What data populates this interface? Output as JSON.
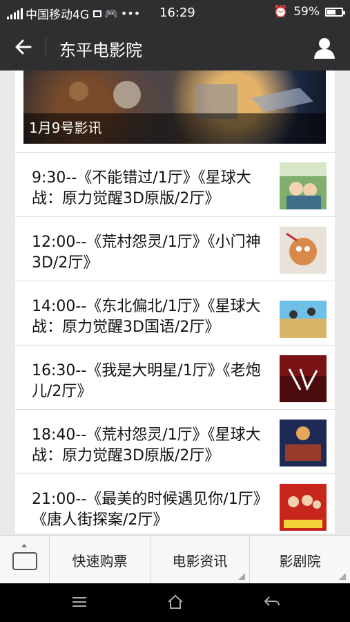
{
  "status": {
    "carrier": "中国移动4G",
    "time": "16:29",
    "battery": "59%",
    "battery_fraction": 0.59
  },
  "header": {
    "title": "东平电影院"
  },
  "banner": {
    "caption": "1月9号影讯"
  },
  "schedule": [
    {
      "text": "9:30--《不能错过/1厅》《星球大战：原力觉醒3D原版/2厅》"
    },
    {
      "text": "12:00--《荒村怨灵/1厅》《小门神3D/2厅》"
    },
    {
      "text": "14:00--《东北偏北/1厅》《星球大战：原力觉醒3D国语/2厅》"
    },
    {
      "text": "16:30--《我是大明星/1厅》《老炮儿/2厅》"
    },
    {
      "text": "18:40--《荒村怨灵/1厅》《星球大战：原力觉醒3D原版/2厅》"
    },
    {
      "text": "21:00--《最美的时候遇见你/1厅》《唐人街探案/2厅》"
    }
  ],
  "bottom_menu": {
    "buy": "快速购票",
    "news": "电影资讯",
    "theater": "影剧院"
  }
}
